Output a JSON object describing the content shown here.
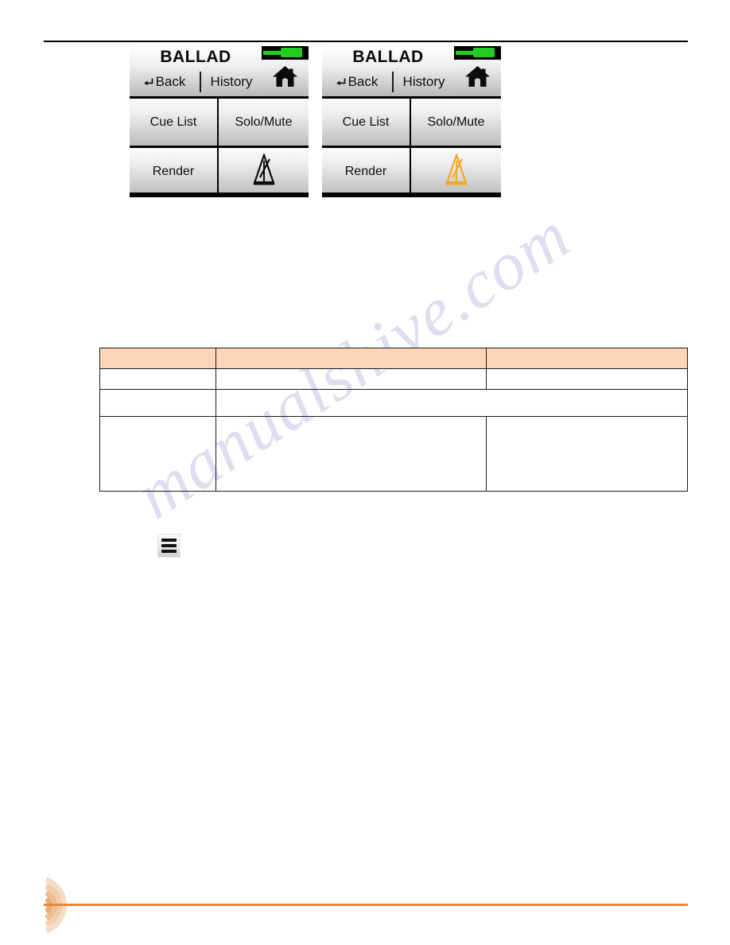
{
  "page": {
    "background_color": "#ffffff",
    "rule_color_top": "#000000",
    "rule_color_bottom": "#E08A3C",
    "watermark_text": "manualshive.com",
    "watermark_color": "#b9b4e0"
  },
  "devices": [
    {
      "id": "device-screen-black-metronome",
      "title": "BALLAD",
      "back_label": "Back",
      "history_label": "History",
      "home_icon": "home-icon",
      "signal_icon": "signal-indicator-icon",
      "signal_color": "#22cc22",
      "buttons": [
        {
          "label": "Cue List",
          "name": "cue-list-button"
        },
        {
          "label": "Solo/Mute",
          "name": "solo-mute-button"
        },
        {
          "label": "Render",
          "name": "render-button"
        }
      ],
      "metronome": {
        "icon": "metronome-icon",
        "color": "#0d0d0d",
        "state": "off"
      }
    },
    {
      "id": "device-screen-orange-metronome",
      "title": "BALLAD",
      "back_label": "Back",
      "history_label": "History",
      "home_icon": "home-icon",
      "signal_icon": "signal-indicator-icon",
      "signal_color": "#22cc22",
      "buttons": [
        {
          "label": "Cue List",
          "name": "cue-list-button"
        },
        {
          "label": "Solo/Mute",
          "name": "solo-mute-button"
        },
        {
          "label": "Render",
          "name": "render-button"
        }
      ],
      "metronome": {
        "icon": "metronome-icon",
        "color": "#F5A623",
        "state": "on"
      }
    }
  ],
  "table": {
    "header_fill": "#FCD6B9",
    "border_color": "#1a1a1a",
    "columns": [
      "",
      "",
      ""
    ],
    "header_cells": [
      "",
      "",
      ""
    ],
    "rows": [
      {
        "cells": [
          "",
          "",
          ""
        ],
        "merged": false
      },
      {
        "cells": [
          "",
          ""
        ],
        "merged": true
      },
      {
        "cells": [
          "",
          "",
          ""
        ],
        "merged": false
      }
    ]
  },
  "hamburger_button": {
    "name": "menu-button",
    "icon": "hamburger-menu-icon",
    "bar_color": "#111111",
    "bars": 3
  },
  "footer": {
    "logo_icon": "concentric-arcs-logo",
    "logo_color": "#E08A3C",
    "rule_color": "#E08A3C"
  }
}
